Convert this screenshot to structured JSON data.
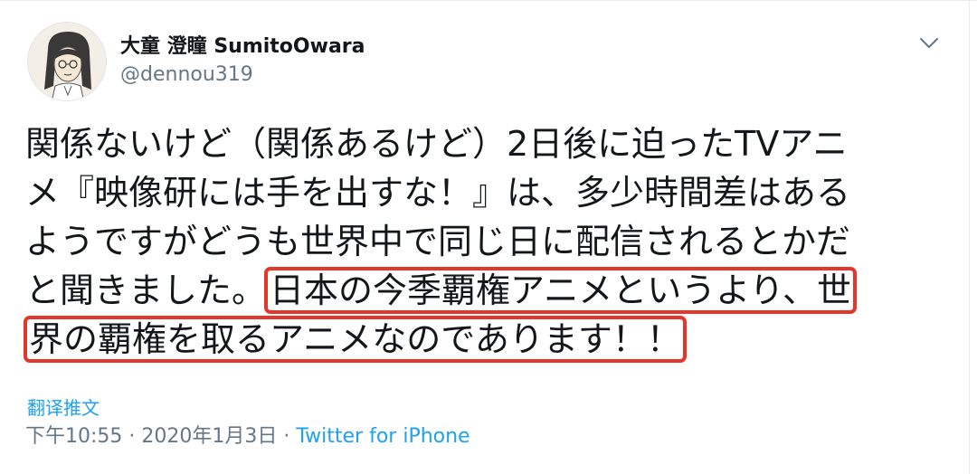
{
  "tweet": {
    "author": {
      "display_name": "大童 澄瞳 SumitoOwara",
      "handle": "@dennou319"
    },
    "text_lines": [
      {
        "plain": "関係ないけど（関係あるけど）2日後に迫ったTVアニ",
        "highlight": ""
      },
      {
        "plain": "メ『映像研には手を出すな！』は、多少時間差はある",
        "highlight": ""
      },
      {
        "plain": "ようですがどうも世界中で同じ日に配信されるとかだ",
        "highlight": ""
      },
      {
        "plain": "と聞きました。",
        "highlight": "日本の今季覇権アニメというより、世"
      },
      {
        "plain": "",
        "highlight": "界の覇権を取るアニメなのであります！！"
      }
    ],
    "translate_label": "翻译推文",
    "time": "下午10:55",
    "separator": " · ",
    "date": "2020年1月3日",
    "source": "Twitter for iPhone"
  },
  "colors": {
    "link": "#1da1f2",
    "highlight_box": "#e5362b",
    "secondary_text": "#657786"
  },
  "icons": {
    "caret": "chevron-down-icon",
    "avatar": "avatar-illustration"
  }
}
